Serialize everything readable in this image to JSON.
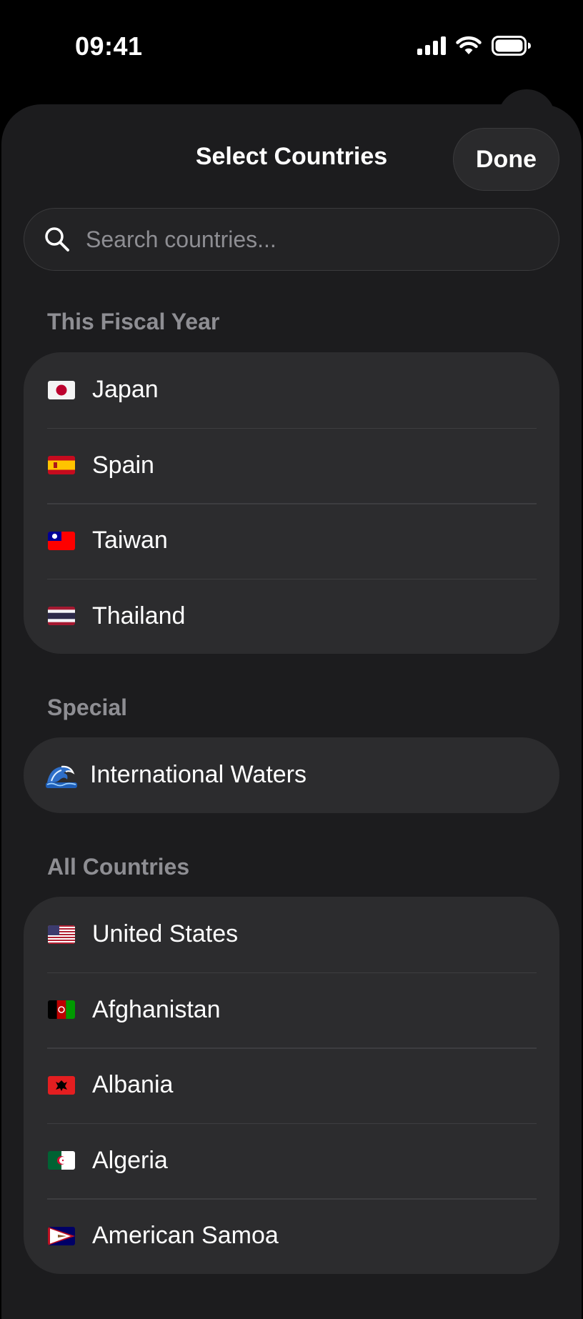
{
  "status_bar": {
    "time": "09:41"
  },
  "sheet": {
    "title": "Select Countries",
    "done_label": "Done"
  },
  "search": {
    "placeholder": "Search countries..."
  },
  "sections": [
    {
      "header": "This Fiscal Year",
      "items": [
        {
          "label": "Japan",
          "icon": "japan-flag-icon"
        },
        {
          "label": "Spain",
          "icon": "spain-flag-icon"
        },
        {
          "label": "Taiwan",
          "icon": "taiwan-flag-icon"
        },
        {
          "label": "Thailand",
          "icon": "thailand-flag-icon"
        }
      ]
    },
    {
      "header": "Special",
      "items": [
        {
          "label": "International Waters",
          "icon": "wave-icon"
        }
      ]
    },
    {
      "header": "All Countries",
      "items": [
        {
          "label": "United States",
          "icon": "united-states-flag-icon"
        },
        {
          "label": "Afghanistan",
          "icon": "afghanistan-flag-icon"
        },
        {
          "label": "Albania",
          "icon": "albania-flag-icon"
        },
        {
          "label": "Algeria",
          "icon": "algeria-flag-icon"
        },
        {
          "label": "American Samoa",
          "icon": "american-samoa-flag-icon"
        }
      ]
    }
  ],
  "colors": {
    "background": "#000000",
    "sheet": "#1c1c1e",
    "group": "#2c2c2e",
    "secondary_text": "#8e8e93"
  }
}
